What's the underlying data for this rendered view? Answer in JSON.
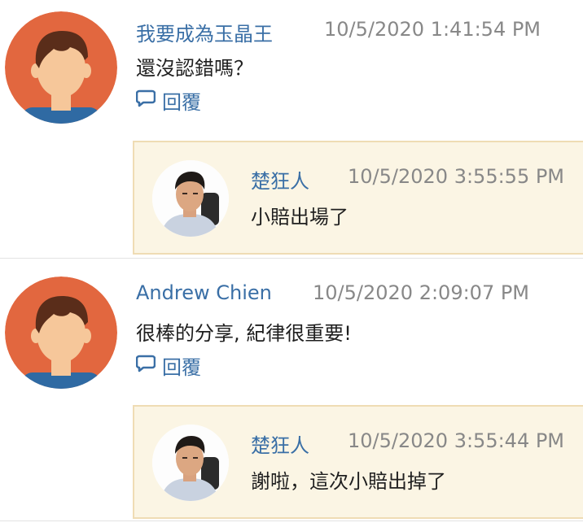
{
  "comments": [
    {
      "author": "我要成為玉晶王",
      "timestamp": "10/5/2020 1:41:54 PM",
      "text": "還沒認錯嗎？",
      "reply_label": "回覆",
      "replies": [
        {
          "author": "楚狂人",
          "timestamp": "10/5/2020 3:55:55 PM",
          "text": "小賠出場了"
        }
      ]
    },
    {
      "author": "Andrew Chien",
      "timestamp": "10/5/2020 2:09:07 PM",
      "text": "很棒的分享, 紀律很重要!",
      "reply_label": "回覆",
      "replies": [
        {
          "author": "楚狂人",
          "timestamp": "10/5/2020 3:55:44 PM",
          "text": "謝啦，這次小賠出掉了"
        }
      ]
    }
  ],
  "colors": {
    "author": "#3a6fa6",
    "timestamp": "#888888",
    "reply_bg": "#fbf5e4",
    "reply_border": "#efdcb4",
    "avatar_bg": "#e2673f"
  },
  "icons": {
    "reply": "speech-bubble-icon",
    "default_avatar": "default-user-avatar",
    "photo_avatar": "user-photo-avatar"
  }
}
